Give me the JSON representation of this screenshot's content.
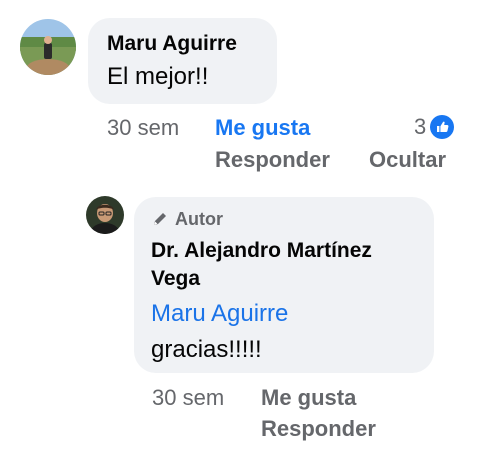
{
  "comment": {
    "author": "Maru Aguirre",
    "text": "El mejor!!",
    "time": "30 sem",
    "like_label": "Me gusta",
    "reaction_count": "3",
    "reply_label": "Responder",
    "hide_label": "Ocultar",
    "reaction_icon": "thumbs-up-icon"
  },
  "reply": {
    "badge_icon": "pencil-icon",
    "badge_label": "Autor",
    "author_line1": "Dr. Alejandro Martínez",
    "author_line2": "Vega",
    "mention": "Maru Aguirre",
    "text": "gracias!!!!!",
    "time": "30 sem",
    "like_label": "Me gusta",
    "reply_label": "Responder"
  },
  "colors": {
    "bubble": "#f0f2f5",
    "link_blue": "#1877f2",
    "mention_blue": "#1a73e8",
    "meta_gray": "#65676b"
  }
}
